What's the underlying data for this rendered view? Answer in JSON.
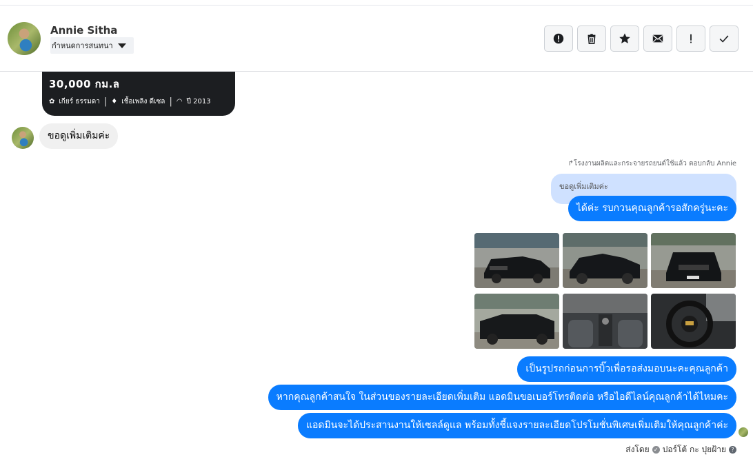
{
  "header": {
    "contact_name": "Annie Sitha",
    "conversation_select": "กำหนดการสนทนา",
    "actions": [
      {
        "name": "report-spam",
        "icon": "alert-circle-icon"
      },
      {
        "name": "delete",
        "icon": "trash-icon"
      },
      {
        "name": "star",
        "icon": "star-icon"
      },
      {
        "name": "mark-unread",
        "icon": "envelope-icon"
      },
      {
        "name": "important",
        "icon": "exclamation-icon"
      },
      {
        "name": "mark-done",
        "icon": "checkmark-icon"
      }
    ]
  },
  "listing_card": {
    "mileage": "30,000 กม.ล",
    "transmission": "เกียร์ ธรรมดา",
    "fuel": "เชื้อเพลิง ดีเซล",
    "year": "ปี 2013"
  },
  "incoming": {
    "text": "ขอดูเพิ่มเติมค่ะ"
  },
  "reply": {
    "meta": "โรงงานผลิตและกระจายรถยนต์ใช้แล้ว ตอบกลับ Annie",
    "quoted": "ขอดูเพิ่มเติมค่ะ",
    "text": "ได้ค่ะ รบกวนคุณลูกค้ารอสักครู่นะคะ"
  },
  "photos": [
    {
      "name": "car-front-side-photo"
    },
    {
      "name": "car-side-photo"
    },
    {
      "name": "car-front-photo"
    },
    {
      "name": "car-rear-photo"
    },
    {
      "name": "car-interior-gear-photo"
    },
    {
      "name": "car-steering-wheel-photo"
    }
  ],
  "outgoing": [
    "เป็นรูปรถก่อนการบิ๊วเพื่อรอส่งมอบนะคะคุณลูกค้า",
    "หากคุณลูกค้าสนใจ ในส่วนของรายละเอียดเพิ่มเติม แอดมินขอเบอร์โทรติดต่อ หรือไอดีไลน์คุณลูกค้าได้ไหมคะ",
    "แอดมินจะได้ประสานงานให้เซลล์ดูแล พร้อมทั้งชี้แจงรายละเอียดโปรโมชั่นพิเศษเพิ่มเติมให้คุณลูกค้าค่ะ"
  ],
  "footer": {
    "sent_by_label": "ส่งโดย",
    "sender": "ปอร์โต้ กะ ปุยฝ้าย",
    "help": "?"
  },
  "colors": {
    "outgoing_bubble": "#0a7cff",
    "quoted_bubble": "#cfe1ff",
    "incoming_bubble": "#f0f0f0"
  }
}
